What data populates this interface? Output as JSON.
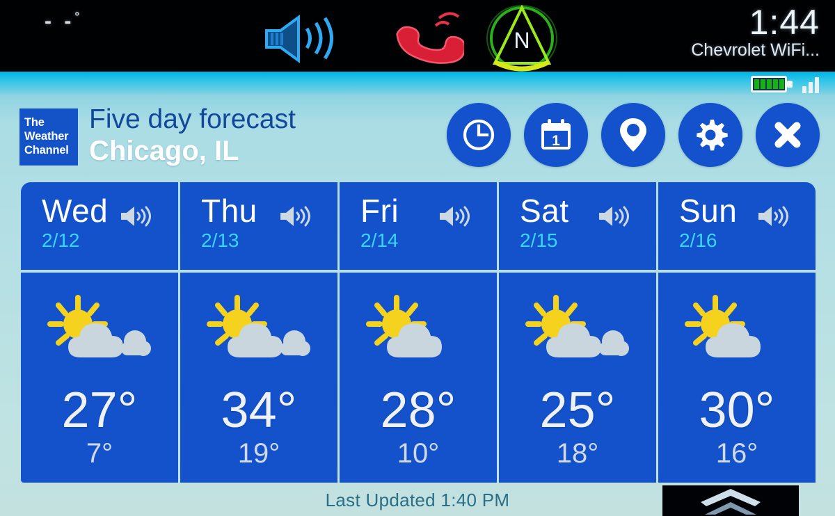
{
  "statusbar": {
    "outside_temp": "- -",
    "degree_symbol": "°",
    "icons": [
      {
        "name": "volume-speaker-icon",
        "label": "volume",
        "color": "#2aa8f0"
      },
      {
        "name": "phone-handset-icon",
        "label": "phone",
        "color": "#e0233a"
      },
      {
        "name": "compass-north-icon",
        "label": "compass",
        "letter": "N",
        "color": "#46e020"
      }
    ],
    "clock": "1:44",
    "connection": "Chevrolet WiFi...",
    "battery": {
      "name": "battery-icon",
      "bars": 5,
      "color": "#17b017"
    },
    "signal": {
      "name": "signal-bars-icon",
      "bars": 3
    }
  },
  "header": {
    "logo": {
      "line1": "The",
      "line2": "Weather",
      "line3": "Channel"
    },
    "title": "Five day forecast",
    "location": "Chicago, IL",
    "actions": [
      {
        "name": "hourly-clock-button",
        "icon": "clock-icon",
        "label": "Hourly"
      },
      {
        "name": "daily-calendar-button",
        "icon": "calendar-icon",
        "label": "Daily",
        "day_number": "1"
      },
      {
        "name": "location-button",
        "icon": "map-pin-icon",
        "label": "Location"
      },
      {
        "name": "settings-button",
        "icon": "gear-icon",
        "label": "Settings"
      },
      {
        "name": "close-button",
        "icon": "close-x-icon",
        "label": "Close"
      }
    ]
  },
  "forecast": {
    "days": [
      {
        "day": "Wed",
        "date": "2/12",
        "condition": "partly-cloudy",
        "high": "27°",
        "low": "7°",
        "speaker": "speaker-icon"
      },
      {
        "day": "Thu",
        "date": "2/13",
        "condition": "partly-cloudy",
        "high": "34°",
        "low": "19°",
        "speaker": "speaker-icon"
      },
      {
        "day": "Fri",
        "date": "2/14",
        "condition": "partly-cloudy",
        "high": "28°",
        "low": "10°",
        "speaker": "speaker-icon"
      },
      {
        "day": "Sat",
        "date": "2/15",
        "condition": "partly-cloudy",
        "high": "25°",
        "low": "18°",
        "speaker": "speaker-icon"
      },
      {
        "day": "Sun",
        "date": "2/16",
        "condition": "partly-cloudy",
        "high": "30°",
        "low": "16°",
        "speaker": "speaker-icon"
      }
    ]
  },
  "footer": {
    "last_updated": "Last Updated 1:40 PM",
    "drawer_handle": "double-chevron-up-icon"
  },
  "colors": {
    "panel_blue": "#1452cc",
    "accent_cyan": "#35d8fb",
    "app_bg": "#b4dfe4",
    "title_blue": "#12489c",
    "sun_yellow": "#f5d21e",
    "cloud_gray": "#c9d6dd"
  }
}
